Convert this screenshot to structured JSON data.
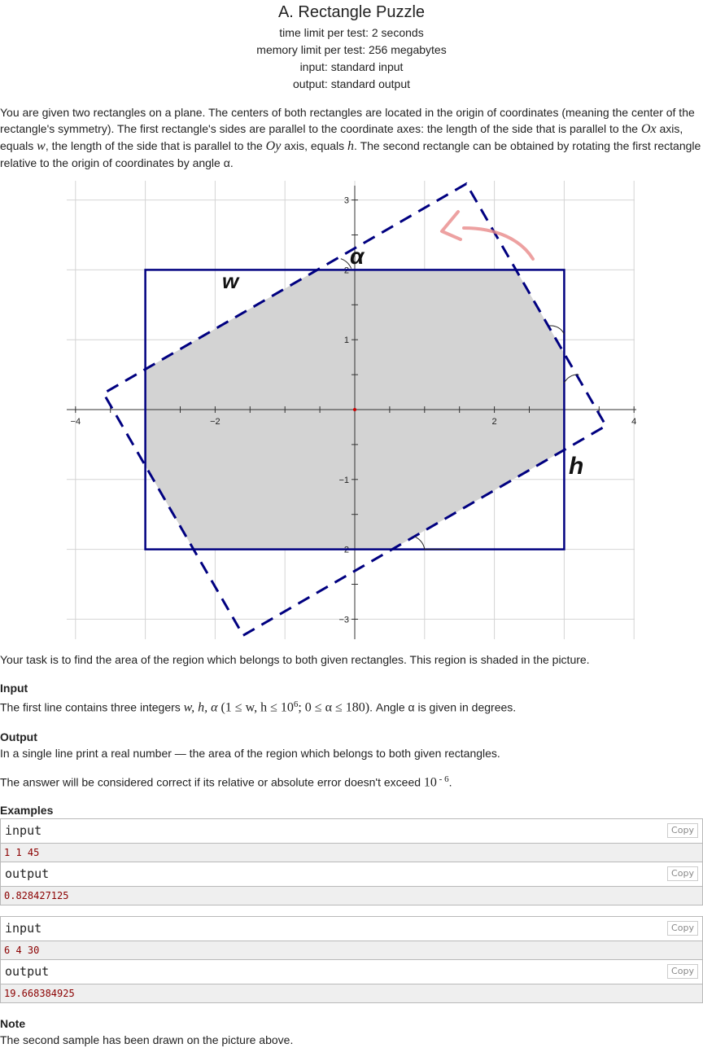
{
  "problem": {
    "title": "A. Rectangle Puzzle",
    "time_limit": "time limit per test: 2 seconds",
    "memory_limit": "memory limit per test: 256 megabytes",
    "input": "input: standard input",
    "output": "output: standard output"
  },
  "statement": {
    "p1_a": "You are given two rectangles on a plane. The centers of both rectangles are located in the origin of coordinates (meaning the center of the rectangle's symmetry). The first rectangle's sides are parallel to the coordinate axes: the length of the side that is parallel to the ",
    "ox": "Ox",
    "p1_b": " axis, equals ",
    "w": "w",
    "p1_c": ", the length of the side that is parallel to the ",
    "oy": "Oy",
    "p1_d": " axis, equals ",
    "h": "h",
    "p1_e": ". The second rectangle can be obtained by rotating the first rectangle relative to the origin of coordinates by angle α.",
    "task": "Your task is to find the area of the region which belongs to both given rectangles. This region is shaded in the picture."
  },
  "figure": {
    "tick_labels_x": [
      "−4",
      "−2",
      "2",
      "4"
    ],
    "tick_labels_y": [
      "3",
      "2",
      "1",
      "−1",
      "−2",
      "−3"
    ],
    "label_w": "w",
    "label_h": "h",
    "label_alpha": "α",
    "rect_w": 6,
    "rect_h": 4,
    "angle_deg": 30
  },
  "input_section": {
    "title": "Input",
    "text_a": "The first line contains three integers ",
    "vars": "w, h, α",
    "constraint": "(1 ≤ w, h ≤ 10",
    "sup": "6",
    "constraint_b": "; 0 ≤ α ≤ 180)",
    "text_b": ". Angle α is given in degrees."
  },
  "output_section": {
    "title": "Output",
    "text": "In a single line print a real number — the area of the region which belongs to both given rectangles.",
    "precision_a": "The answer will be considered correct if its relative or absolute error doesn't exceed ",
    "precision_base": "10",
    "precision_exp": " - 6",
    "precision_b": "."
  },
  "examples": {
    "title": "Examples",
    "copy_label": "Copy",
    "input_label": "input",
    "output_label": "output",
    "items": [
      {
        "input": "1 1 45",
        "output": "0.828427125"
      },
      {
        "input": "6 4 30",
        "output": "19.668384925"
      }
    ]
  },
  "note": {
    "title": "Note",
    "text": "The second sample has been drawn on the picture above."
  },
  "colors": {
    "rect": "#000080",
    "shade": "#d3d3d3",
    "grid": "#d4d4d4",
    "arrow": "#e88a8a"
  }
}
